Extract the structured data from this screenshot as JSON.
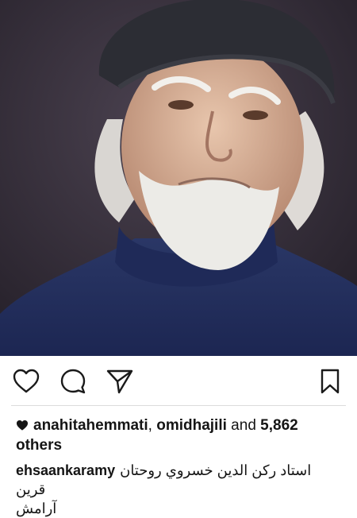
{
  "post": {
    "photo_icon": "portrait-photo",
    "likes": {
      "user1": "anahitahemmati",
      "separator": ", ",
      "user2": "omidhajili",
      "connector": " and ",
      "count_others": "5,862 others"
    },
    "caption": {
      "username": "ehsaankaramy",
      "text_line1": "استاد رکن الدین خسروي روحتان قرین",
      "text_line2": "آرامش"
    }
  },
  "actions": {
    "like_icon": "heart-icon",
    "comment_icon": "comment-icon",
    "share_icon": "share-icon",
    "save_icon": "bookmark-icon"
  },
  "colors": {
    "text": "#151515",
    "separator": "#dcdcdc",
    "photo_bg": "#2e2733"
  }
}
